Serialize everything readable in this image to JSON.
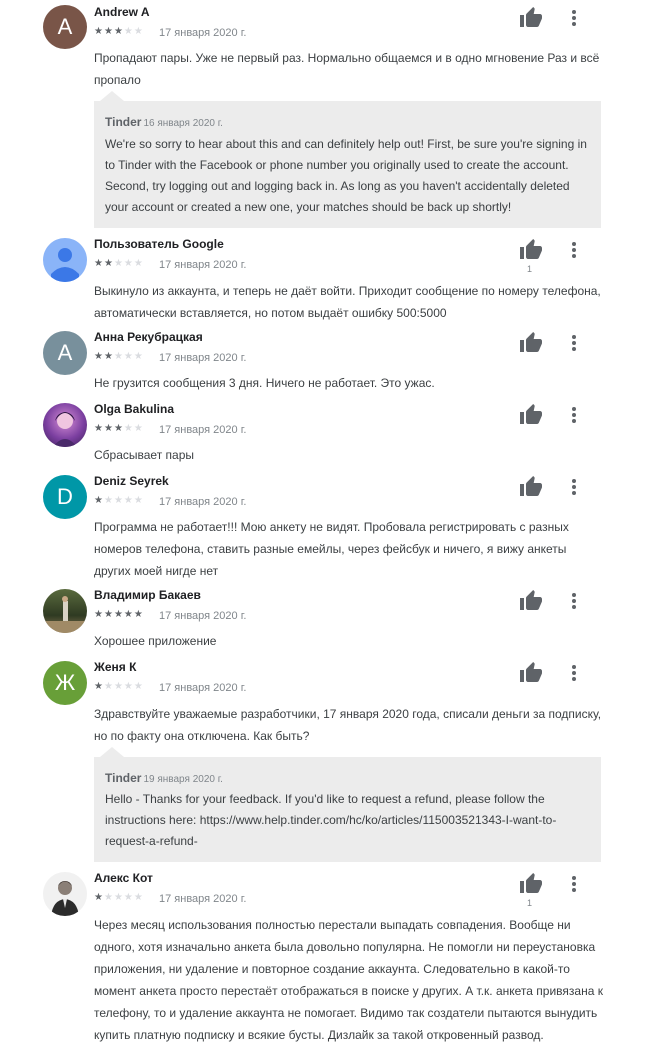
{
  "icons": {
    "thumb": "thumb-up-icon",
    "more": "more-vert-icon",
    "person": "person-icon"
  },
  "colors": {
    "avatar_a1": "#795548",
    "avatar_google": "#8ab4f8",
    "avatar_a2": "#78909c",
    "avatar_d": "#0097a7",
    "avatar_zh": "#689f38"
  },
  "reviews": [
    {
      "author": "Andrew A",
      "rating": 3,
      "date": "17 января 2020 г.",
      "avatar_letter": "A",
      "text": "Пропадают пары. Уже не первый раз. Нормально общаемся и в одно мгновение Раз и всё пропало",
      "reply": {
        "developer": "Tinder",
        "date": "16 января 2020 г.",
        "text": "We're so sorry to hear about this and can definitely help out! First, be sure you're signing in to Tinder with the Facebook or phone number you originally used to create the account. Second, try logging out and logging back in. As long as you haven't accidentally deleted your account or created a new one, your matches should be back up shortly!"
      }
    },
    {
      "author": "Пользователь Google",
      "rating": 2,
      "date": "17 января 2020 г.",
      "helpful_count": "1",
      "text": "Выкинуло из аккаунта, и теперь не даёт войти. Приходит сообщение по номеру телефона, автоматически вставляется, но потом выдаёт ошибку 500:5000"
    },
    {
      "author": "Анна Рекубрацкая",
      "rating": 2,
      "date": "17 января 2020 г.",
      "avatar_letter": "А",
      "text": "Не грузится сообщения 3 дня. Ничего не работает. Это ужас."
    },
    {
      "author": "Olga Bakulina",
      "rating": 3,
      "date": "17 января 2020 г.",
      "text": "Сбрасывает пары"
    },
    {
      "author": "Deniz Seyrek",
      "rating": 1,
      "date": "17 января 2020 г.",
      "avatar_letter": "D",
      "text": "Программа не работает!!! Мою анкету не видят. Пробовала регистрировать с разных номеров телефона, ставить разные емейлы, через фейсбук и ничего, я вижу анкеты других моей нигде нет"
    },
    {
      "author": "Владимир Бакаев",
      "rating": 5,
      "date": "17 января 2020 г.",
      "text": "Хорошее приложение"
    },
    {
      "author": "Женя К",
      "rating": 1,
      "date": "17 января 2020 г.",
      "avatar_letter": "Ж",
      "text": "Здравствуйте уважаемые разработчики, 17 января 2020 года, списали деньги за подписку, но по факту она отключена. Как быть?",
      "reply": {
        "developer": "Tinder",
        "date": "19 января 2020 г.",
        "text": "Hello - Thanks for your feedback. If you'd like to request a refund, please follow the instructions here: https://www.help.tinder.com/hc/ko/articles/115003521343-I-want-to-request-a-refund-"
      }
    },
    {
      "author": "Алекс Кот",
      "rating": 1,
      "date": "17 января 2020 г.",
      "helpful_count": "1",
      "text": "Через месяц использования полностью перестали выпадать совпадения. Вообще ни одного, хотя изначально анкета была довольно популярна. Не помогли ни переустановка приложения, ни удаление и повторное создание аккаунта. Следовательно в какой-то момент анкета просто перестаёт отображаться в поиске у других. А т.к. анкета привязана к телефону, то и удаление аккаунта не помогает. Видимо так создатели пытаются вынудить купить платную подписку и всякие бусты. Дизлайк за такой откровенный развод."
    }
  ]
}
